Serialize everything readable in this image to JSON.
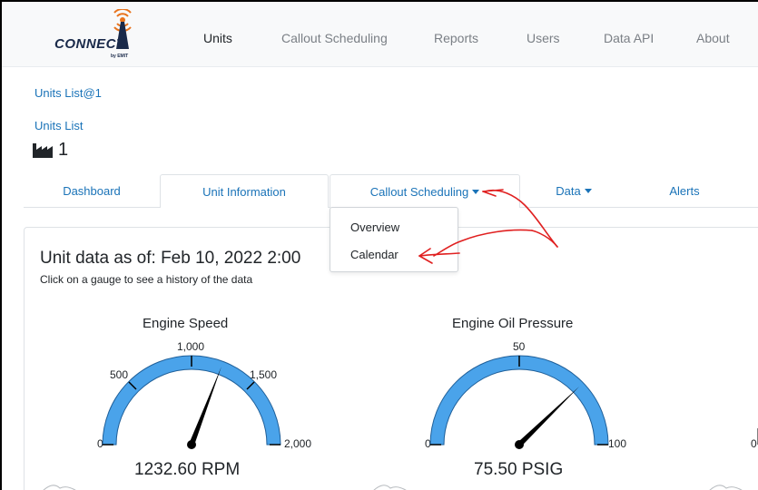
{
  "app": {
    "logo_text": "CONNECT",
    "logo_sub": "by EMIT"
  },
  "nav": {
    "items": [
      {
        "label": "Units",
        "active": true
      },
      {
        "label": "Callout Scheduling",
        "active": false
      },
      {
        "label": "Reports",
        "active": false
      },
      {
        "label": "Users",
        "active": false
      },
      {
        "label": "Data API",
        "active": false
      },
      {
        "label": "About",
        "active": false
      }
    ]
  },
  "breadcrumb": {
    "top": "Units List@1",
    "parent": "Units List"
  },
  "unit": {
    "icon": "factory-icon",
    "name": "1"
  },
  "tabs": [
    {
      "label": "Dashboard"
    },
    {
      "label": "Unit Information"
    },
    {
      "label": "Callout Scheduling",
      "dropdown": true,
      "open": true
    },
    {
      "label": "Data",
      "dropdown": true
    },
    {
      "label": "Alerts"
    }
  ],
  "dropdown": {
    "items": [
      "Overview",
      "Calendar"
    ]
  },
  "card": {
    "title": "Unit data as of: Feb 10, 2022 2:00",
    "subtitle": "Click on a gauge to see a history of the data"
  },
  "gauges": [
    {
      "title": "Engine Speed",
      "value_text": "1232.60 RPM",
      "value": 1232.6,
      "min": 0,
      "max": 2000,
      "ticks": [
        "0",
        "500",
        "1,000",
        "1,500",
        "2,000"
      ]
    },
    {
      "title": "Engine Oil Pressure",
      "value_text": "75.50 PSIG",
      "value": 75.5,
      "min": 0,
      "max": 100,
      "ticks": [
        "0",
        "50",
        "100"
      ]
    },
    {
      "partial_tick": "0"
    }
  ],
  "colors": {
    "link": "#1a73b8",
    "gauge_fill": "#4aa3ea",
    "annotation": "#e02020"
  }
}
